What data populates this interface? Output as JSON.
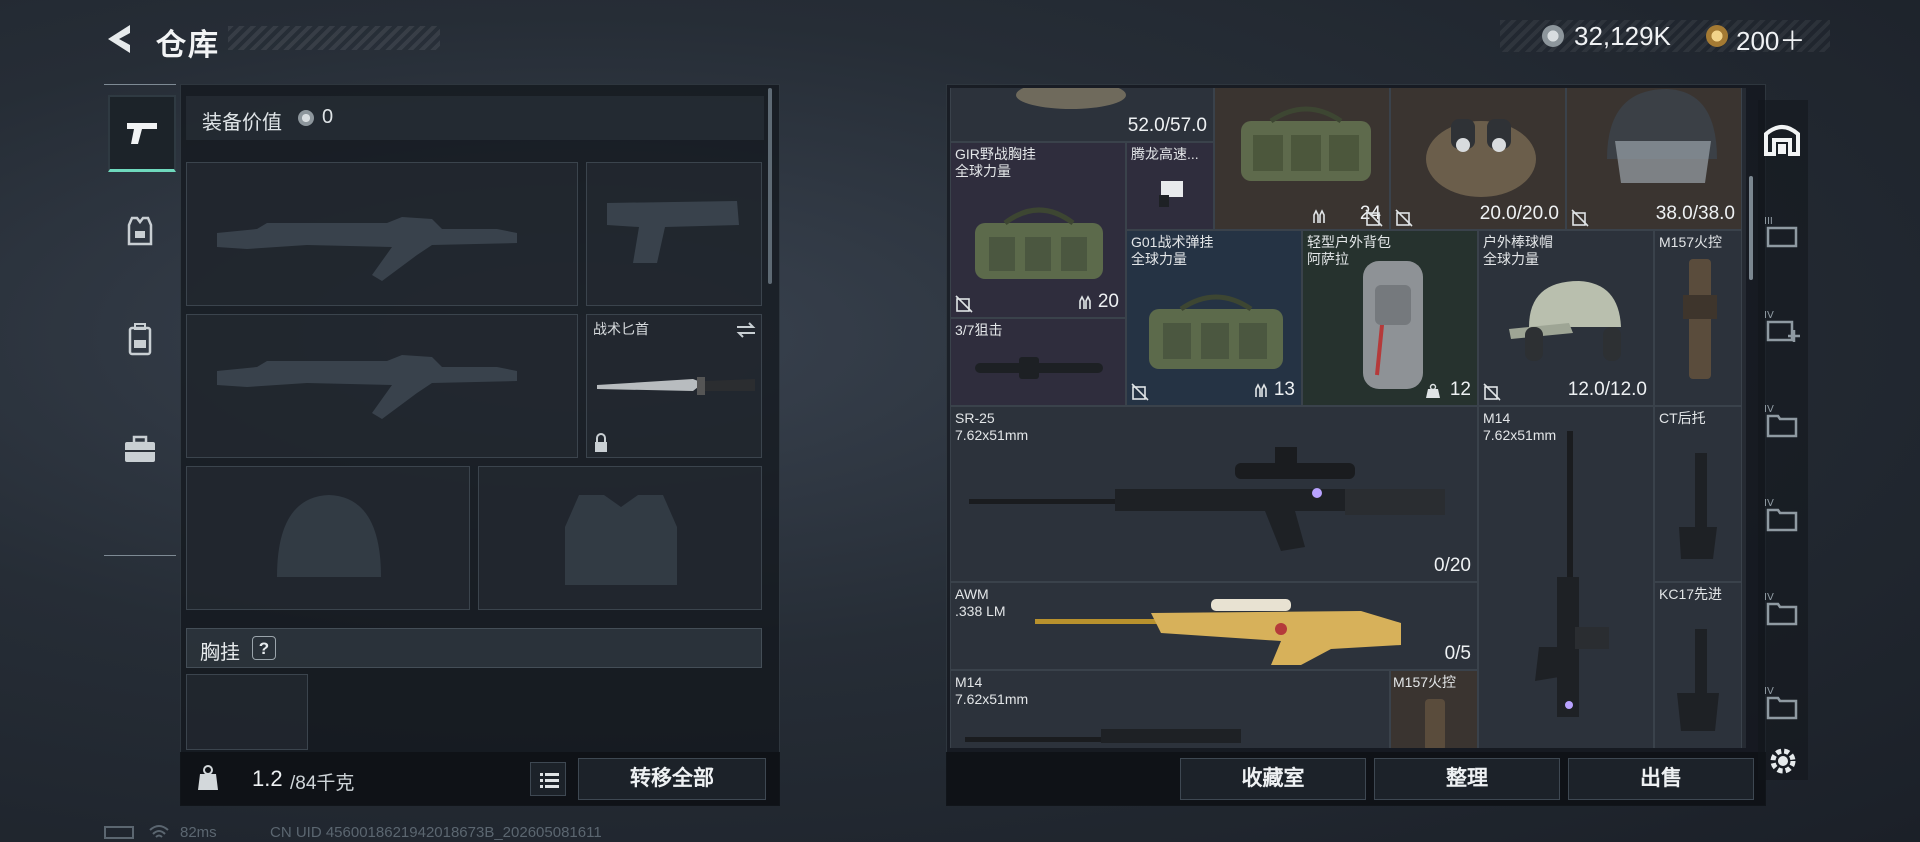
{
  "header": {
    "title": "仓库"
  },
  "currency": {
    "silver": "32,129K",
    "gold": "200＋"
  },
  "left_panel": {
    "equipment_value_label": "装备价值",
    "equipment_value": "0",
    "melee_slot_label": "战术匕首",
    "chest_rig_label": "胸挂",
    "chest_rig_help": "?",
    "weight_current": "1.2",
    "weight_max": "/84千克",
    "transfer_all_label": "转移全部"
  },
  "inventory": {
    "items": [
      {
        "name": "",
        "value": "52.0/57.0"
      },
      {
        "name": "",
        "value": "24"
      },
      {
        "name": "",
        "value": "20.0/20.0"
      },
      {
        "name": "",
        "value": "38.0/38.0"
      },
      {
        "name": "GIR野战胸挂\n全球力量",
        "value": "20"
      },
      {
        "name": "腾龙高速...",
        "value": ""
      },
      {
        "name": "3/7狙击",
        "value": ""
      },
      {
        "name": "G01战术弹挂\n全球力量",
        "value": "13"
      },
      {
        "name": "轻型户外背包\n阿萨拉",
        "value": "12"
      },
      {
        "name": "户外棒球帽\n全球力量",
        "value": "12.0/12.0"
      },
      {
        "name": "M157火控",
        "value": ""
      },
      {
        "name": "SR-25\n7.62x51mm",
        "value": "0/20"
      },
      {
        "name": "M14\n7.62x51mm",
        "value": ""
      },
      {
        "name": "CT后托",
        "value": ""
      },
      {
        "name": "AWM\n.338 LM",
        "value": "0/5"
      },
      {
        "name": "KC17先进",
        "value": ""
      },
      {
        "name": "M14\n7.62x51mm",
        "value": ""
      },
      {
        "name": "M157火控",
        "value": ""
      }
    ]
  },
  "bottom_buttons": {
    "collection": "收藏室",
    "organize": "整理",
    "sell": "出售"
  },
  "status": {
    "ping": "82ms",
    "uid": "CN UID 4560018621942018673B_202605081611"
  },
  "colors": {
    "accent": "#6fd9bd",
    "panel": "#12161c"
  }
}
